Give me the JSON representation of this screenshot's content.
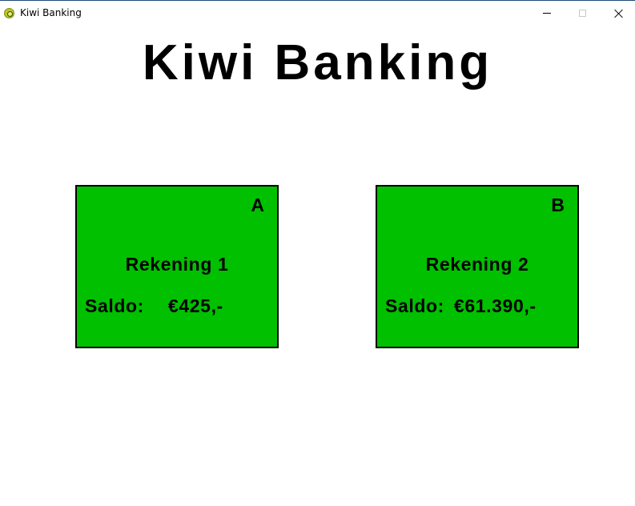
{
  "window": {
    "title": "Kiwi Banking",
    "icon": "kiwi-app-icon"
  },
  "header": {
    "title": "Kiwi Banking"
  },
  "colors": {
    "card_background": "#00c000",
    "card_border": "#000000",
    "text": "#000000",
    "page_background": "#ffffff"
  },
  "accounts": [
    {
      "letter": "A",
      "name": "Rekening 1",
      "balance_label": "Saldo:",
      "balance": "€425,-"
    },
    {
      "letter": "B",
      "name": "Rekening 2",
      "balance_label": "Saldo:",
      "balance": "€61.390,-"
    }
  ]
}
